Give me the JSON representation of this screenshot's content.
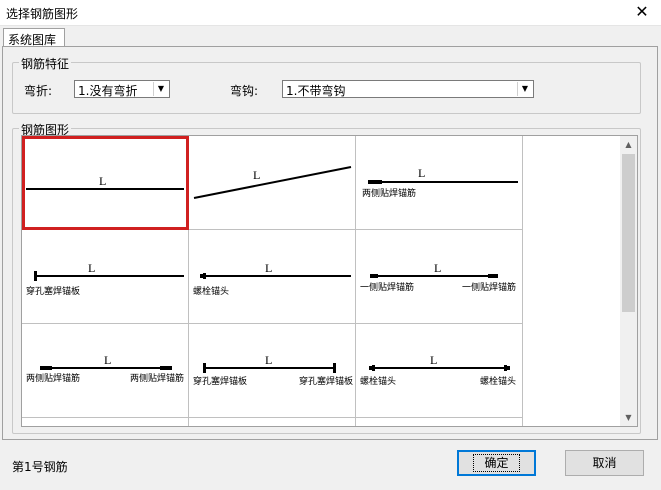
{
  "window": {
    "title": "选择钢筋图形",
    "close_glyph": "✕"
  },
  "tab": {
    "label": "系统图库"
  },
  "features": {
    "legend": "钢筋特征",
    "bend_label": "弯折:",
    "bend_value": "1.没有弯折",
    "hook_label": "弯钩:",
    "hook_value": "1.不带弯钩"
  },
  "shapes": {
    "legend": "钢筋图形",
    "items": [
      {
        "label": "L",
        "captions": []
      },
      {
        "label": "L",
        "captions": []
      },
      {
        "label": "L",
        "captions": [
          "两侧贴焊锚筋"
        ]
      },
      {
        "label": "L",
        "captions": [
          "穿孔塞焊锚板"
        ]
      },
      {
        "label": "L",
        "captions": [
          "螺栓锚头"
        ]
      },
      {
        "label": "L",
        "captions": [
          "一侧贴焊锚筋",
          "一侧贴焊锚筋"
        ]
      },
      {
        "label": "L",
        "captions": [
          "两侧贴焊锚筋",
          "两侧贴焊锚筋"
        ]
      },
      {
        "label": "L",
        "captions": [
          "穿孔塞焊锚板",
          "穿孔塞焊锚板"
        ]
      },
      {
        "label": "L",
        "captions": [
          "螺栓锚头",
          "螺栓锚头"
        ]
      }
    ]
  },
  "status": {
    "text": "第1号钢筋"
  },
  "buttons": {
    "ok": "确定",
    "cancel": "取消"
  },
  "colors": {
    "selection": "#d02020",
    "focus": "#0078d7"
  }
}
